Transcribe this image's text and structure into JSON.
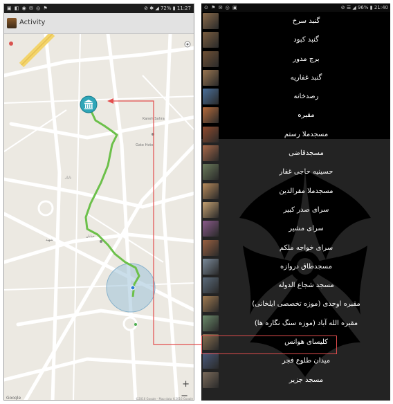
{
  "left_phone": {
    "status_bar": {
      "left_icons": "▣ ◧ ◉ ✉ ◎ ⚑",
      "right": "⊘ ✱ ◢ 72% ▮ 11:27"
    },
    "app_title": "Activity",
    "map_labels": [
      "Gate Hotel",
      "Kaneh Sahra",
      "بازار",
      "خیابان",
      "شهید"
    ],
    "zoom_in": "+",
    "zoom_out": "−",
    "google": "Google",
    "attribution": "©2016 Google · Map data ©2016 Google"
  },
  "right_phone": {
    "status_bar": {
      "left_icons": "⊙ ⚑ ✉ ◎ ▣",
      "right": "⊘ ☰ ◢ 96% ▮ 21:40"
    },
    "places": [
      {
        "label": "گنبد سرخ",
        "thumb_color": "#8a6a4a"
      },
      {
        "label": "گنبد کبود",
        "thumb_color": "#7a5c3e"
      },
      {
        "label": "برج مدور",
        "thumb_color": "#6f5034"
      },
      {
        "label": "گنبد غفاریه",
        "thumb_color": "#9a7550"
      },
      {
        "label": "رصدخانه",
        "thumb_color": "#4a6f9a"
      },
      {
        "label": "مقبره",
        "thumb_color": "#b56a3a"
      },
      {
        "label": "مسجدملا رستم",
        "thumb_color": "#8f4a2c"
      },
      {
        "label": "مسجدقاضی",
        "thumb_color": "#a86848"
      },
      {
        "label": "حسینیه حاجی غفار",
        "thumb_color": "#6a7a5a"
      },
      {
        "label": "مسجدملا مقرالدین",
        "thumb_color": "#b88a5a"
      },
      {
        "label": "سرای صدر کبیر",
        "thumb_color": "#c4a070"
      },
      {
        "label": "سرای مشیر",
        "thumb_color": "#8a5a8a"
      },
      {
        "label": "سرای خواجه ملکم",
        "thumb_color": "#9a6040"
      },
      {
        "label": "مسجدطاق دروازه",
        "thumb_color": "#7a8a9a"
      },
      {
        "label": "مسجد شجاع الدوله",
        "thumb_color": "#5a6a7a"
      },
      {
        "label": "مقبره اوحدی (موزه تخصصی ایلخانی)",
        "thumb_color": "#a07a50"
      },
      {
        "label": "مقبره الله آباد (موزه سنگ نگاره ها)",
        "thumb_color": "#6a8a6a"
      },
      {
        "label": "کلیسای هوانس",
        "thumb_color": "#8a7050"
      },
      {
        "label": "میدان طلوع فجر",
        "thumb_color": "#4a5a7a"
      },
      {
        "label": "مسجد جزیر",
        "thumb_color": "#7a6a5a"
      }
    ]
  }
}
